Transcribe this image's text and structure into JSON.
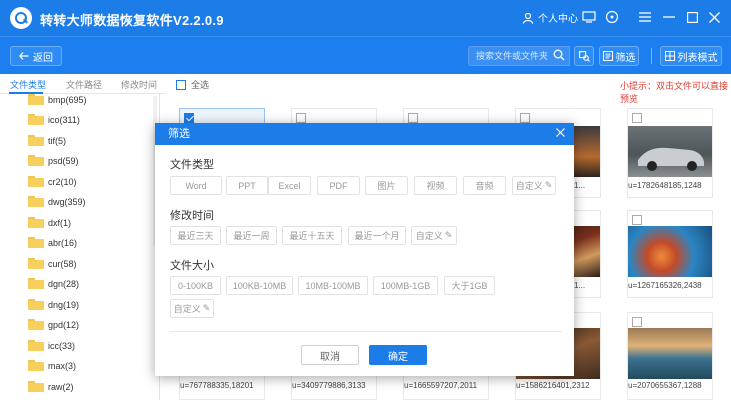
{
  "app": {
    "title": "转转大师数据恢复软件V2.2.0.9",
    "user_center": "个人中心"
  },
  "toolbar": {
    "back_label": "返回",
    "search_placeholder": "搜索文件或文件夹",
    "filter_label": "筛选",
    "list_mode_label": "列表模式"
  },
  "tabs": [
    "文件类型",
    "文件路径",
    "修改时间"
  ],
  "select_all": "全选",
  "tip": "小提示：双击文件可以直接预览",
  "sidebar": {
    "items": [
      "bmp(695)",
      "ico(311)",
      "tif(5)",
      "psd(59)",
      "cr2(10)",
      "dwg(359)",
      "dxf(1)",
      "abr(16)",
      "cur(58)",
      "dgn(28)",
      "dng(19)",
      "gpd(12)",
      "icc(33)",
      "max(3)",
      "raw(2)"
    ]
  },
  "grid": {
    "captions_row1": [
      "u=1782648185,1248"
    ],
    "captions_row1_partial": "1...",
    "captions_row2": [
      "u=1267165326,2438"
    ],
    "captions_row2_partial": "1...",
    "captions_row3": [
      "u=767788335,18201",
      "u=3409779886,3133",
      "u=1665597207,2011",
      "u=1586216401,2312",
      "u=2070655367,1288"
    ],
    "thumb_colors": {
      "car": "#5d6468",
      "reef": "#2a7db5",
      "sunset": "#b8743a",
      "coast": "#3a6f8e",
      "dark": "#3a2d28"
    }
  },
  "dialog": {
    "title": "筛选",
    "file_type_label": "文件类型",
    "file_types": [
      "Word",
      "PPT",
      "Excel",
      "PDF",
      "图片",
      "视频",
      "音频",
      "自定义"
    ],
    "time_label": "修改时间",
    "times": [
      "最近三天",
      "最近一周",
      "最近十五天",
      "最近一个月",
      "自定义"
    ],
    "size_label": "文件大小",
    "sizes": [
      "0-100KB",
      "100KB-10MB",
      "10MB-100MB",
      "100MB-1GB",
      "大于1GB",
      "自定义"
    ],
    "cancel": "取消",
    "ok": "确定"
  }
}
